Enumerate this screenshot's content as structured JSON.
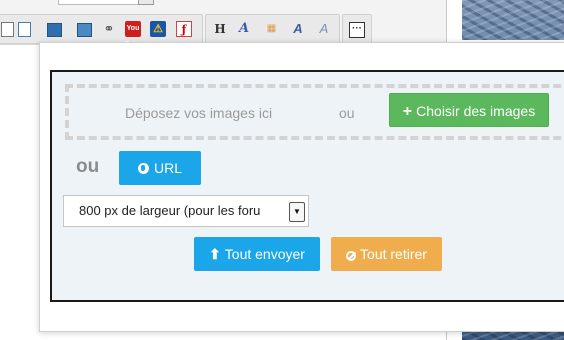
{
  "toolbar": {
    "icons_group1": [
      "document-icon",
      "image-icon",
      "image-add-icon",
      "link-icon",
      "youtube-icon",
      "warning-icon",
      "flash-icon"
    ],
    "icons_group2": [
      "heading-icon",
      "font-color-icon",
      "color-grid-icon",
      "font-icon",
      "font-style-icon"
    ],
    "youtube_text": "You Tube",
    "heading_text": "H",
    "more_text": "···"
  },
  "uploader": {
    "dropzone_text": "Déposez vos images ici",
    "or_small": "ou",
    "choose_button": "Choisir des images",
    "choose_plus": "+",
    "or_big": "ou",
    "url_button": "URL",
    "size_select_value": "800 px de largeur (pour les foru",
    "send_button": "Tout envoyer",
    "remove_button": "Tout retirer"
  },
  "colors": {
    "choose": "#5cb85c",
    "primary": "#1aa6e8",
    "warning": "#f0ad4e"
  }
}
